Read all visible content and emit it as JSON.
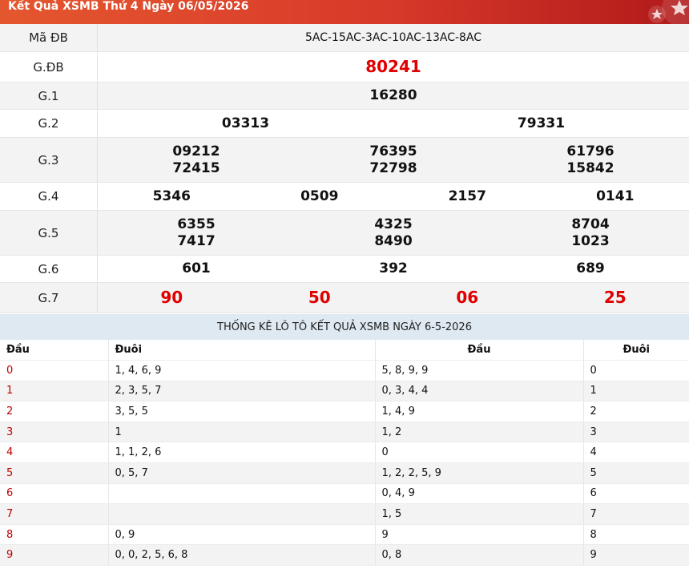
{
  "header": {
    "title": "Kết Quả XSMB Thứ 4 Ngày 06/05/2026"
  },
  "colors": {
    "accent": "#d83a2a",
    "red": "#e00000"
  },
  "prizes": [
    {
      "label": "Mã ĐB",
      "values": [
        "5AC-15AC-3AC-10AC-13AC-8AC"
      ],
      "style": "code"
    },
    {
      "label": "G.ĐB",
      "values": [
        "80241"
      ],
      "style": "special"
    },
    {
      "label": "G.1",
      "values": [
        "16280"
      ]
    },
    {
      "label": "G.2",
      "values": [
        "03313",
        "79331"
      ]
    },
    {
      "label": "G.3",
      "values": [
        [
          "09212",
          "72415"
        ],
        [
          "76395",
          "72798"
        ],
        [
          "61796",
          "15842"
        ]
      ]
    },
    {
      "label": "G.4",
      "values": [
        "5346",
        "0509",
        "2157",
        "0141"
      ]
    },
    {
      "label": "G.5",
      "values": [
        [
          "6355",
          "7417"
        ],
        [
          "4325",
          "8490"
        ],
        [
          "8704",
          "1023"
        ]
      ]
    },
    {
      "label": "G.6",
      "values": [
        "601",
        "392",
        "689"
      ]
    },
    {
      "label": "G.7",
      "values": [
        "90",
        "50",
        "06",
        "25"
      ],
      "style": "red"
    }
  ],
  "stats": {
    "title": "THỐNG KÊ LÔ TÔ KẾT QUẢ XSMB NGÀY 6-5-2026",
    "headers": [
      "Đầu",
      "Đuôi",
      "Đầu",
      "Đuôi"
    ],
    "rows": [
      [
        "0",
        "1, 4, 6, 9",
        "5, 8, 9, 9",
        "0"
      ],
      [
        "1",
        "2, 3, 5, 7",
        "0, 3, 4, 4",
        "1"
      ],
      [
        "2",
        "3, 5, 5",
        "1, 4, 9",
        "2"
      ],
      [
        "3",
        "1",
        "1, 2",
        "3"
      ],
      [
        "4",
        "1, 1, 2, 6",
        "0",
        "4"
      ],
      [
        "5",
        "0, 5, 7",
        "1, 2, 2, 5, 9",
        "5"
      ],
      [
        "6",
        "",
        "0, 4, 9",
        "6"
      ],
      [
        "7",
        "",
        "1, 5",
        "7"
      ],
      [
        "8",
        "0, 9",
        "9",
        "8"
      ],
      [
        "9",
        "0, 0, 2, 5, 6, 8",
        "0, 8",
        "9"
      ]
    ]
  }
}
